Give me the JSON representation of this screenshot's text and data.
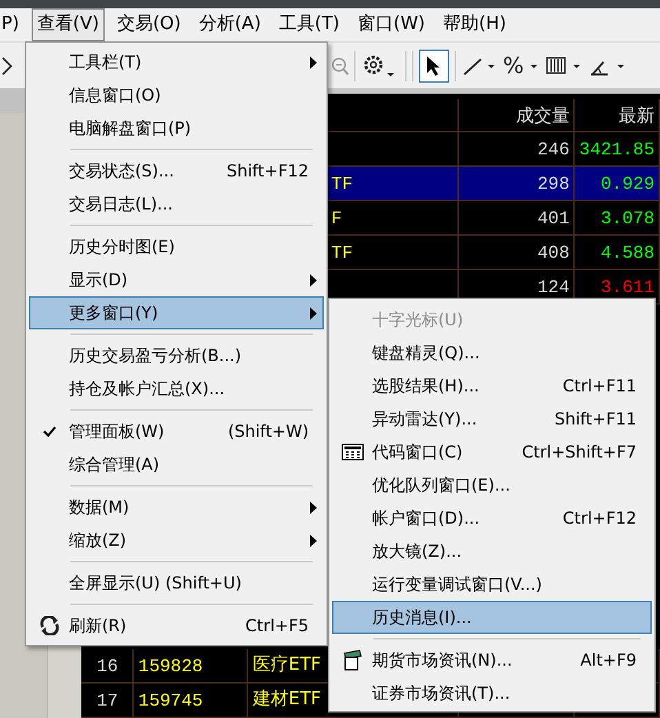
{
  "menubar": {
    "items": [
      {
        "label": "P)",
        "selected": false
      },
      {
        "label": "查看(V)",
        "selected": true
      },
      {
        "label": "交易(O)",
        "selected": false
      },
      {
        "label": "分析(A)",
        "selected": false
      },
      {
        "label": "工具(T)",
        "selected": false
      },
      {
        "label": "窗口(W)",
        "selected": false
      },
      {
        "label": "帮助(H)",
        "selected": false
      }
    ]
  },
  "toolbar": {
    "percent_button": "%"
  },
  "table": {
    "columns": [
      "成交量",
      "最新"
    ],
    "rows_top": [
      {
        "volume": "246",
        "latest": "3421.85",
        "color": "#00ff00",
        "selected": false
      },
      {
        "name": "TF",
        "volume": "298",
        "latest": "0.929",
        "color": "#00ff00",
        "selected": true
      },
      {
        "name": "F",
        "volume": "401",
        "latest": "3.078",
        "color": "#00ff00",
        "selected": false
      },
      {
        "name": "TF",
        "volume": "408",
        "latest": "4.588",
        "color": "#00ff00",
        "selected": false
      },
      {
        "volume": "124",
        "latest": "3.611",
        "color": "#ff0000",
        "selected": false
      }
    ],
    "rows_bottom": [
      {
        "index": "16",
        "code": "159828",
        "name": "医疗ETF",
        "selected": false
      },
      {
        "index": "17",
        "code": "159745",
        "name": "建材ETF",
        "selected": false
      }
    ]
  },
  "view_menu": {
    "items": [
      {
        "kind": "item",
        "label": "工具栏(T)",
        "submenu": true,
        "checked": false,
        "selected": false
      },
      {
        "kind": "item",
        "label": "信息窗口(O)",
        "submenu": false,
        "checked": false,
        "selected": false
      },
      {
        "kind": "item",
        "label": "电脑解盘窗口(P)",
        "submenu": false,
        "checked": false,
        "selected": false
      },
      {
        "kind": "separator"
      },
      {
        "kind": "item",
        "label": "交易状态(S)...",
        "shortcut": "Shift+F12",
        "submenu": false,
        "checked": false,
        "selected": false
      },
      {
        "kind": "item",
        "label": "交易日志(L)...",
        "submenu": false,
        "checked": false,
        "selected": false
      },
      {
        "kind": "separator"
      },
      {
        "kind": "item",
        "label": "历史分时图(E)",
        "submenu": false,
        "checked": false,
        "selected": false
      },
      {
        "kind": "item",
        "label": "显示(D)",
        "submenu": true,
        "checked": false,
        "selected": false
      },
      {
        "kind": "item",
        "label": "更多窗口(Y)",
        "submenu": true,
        "checked": false,
        "selected": true
      },
      {
        "kind": "separator"
      },
      {
        "kind": "item",
        "label": "历史交易盈亏分析(B...)",
        "submenu": false,
        "checked": false,
        "selected": false
      },
      {
        "kind": "item",
        "label": "持仓及帐户汇总(X)...",
        "submenu": false,
        "checked": false,
        "selected": false
      },
      {
        "kind": "separator"
      },
      {
        "kind": "item",
        "label": "管理面板(W)",
        "shortcut": "(Shift+W)",
        "submenu": false,
        "checked": true,
        "selected": false
      },
      {
        "kind": "item",
        "label": "综合管理(A)",
        "submenu": false,
        "checked": false,
        "selected": false
      },
      {
        "kind": "separator"
      },
      {
        "kind": "item",
        "label": "数据(M)",
        "submenu": true,
        "checked": false,
        "selected": false
      },
      {
        "kind": "item",
        "label": "缩放(Z)",
        "submenu": true,
        "checked": false,
        "selected": false
      },
      {
        "kind": "separator"
      },
      {
        "kind": "item",
        "label": "全屏显示(U) (Shift+U)",
        "submenu": false,
        "checked": false,
        "selected": false
      },
      {
        "kind": "separator"
      },
      {
        "kind": "refresh",
        "label": "刷新(R)",
        "shortcut": "Ctrl+F5",
        "submenu": false,
        "checked": false,
        "selected": false
      }
    ]
  },
  "more_windows_menu": {
    "items": [
      {
        "kind": "item",
        "label": "十字光标(U)",
        "disabled": true,
        "selected": false
      },
      {
        "kind": "item",
        "label": "键盘精灵(Q)...",
        "disabled": false,
        "selected": false
      },
      {
        "kind": "item",
        "label": "选股结果(H)...",
        "shortcut": "Ctrl+F11",
        "disabled": false,
        "selected": false
      },
      {
        "kind": "item",
        "label": "异动雷达(Y)...",
        "shortcut": "Shift+F11",
        "disabled": false,
        "selected": false
      },
      {
        "kind": "grid",
        "label": "代码窗口(C)",
        "shortcut": "Ctrl+Shift+F7",
        "disabled": false,
        "selected": false
      },
      {
        "kind": "item",
        "label": "优化队列窗口(E)...",
        "disabled": false,
        "selected": false
      },
      {
        "kind": "item",
        "label": "帐户窗口(D)...",
        "shortcut": "Ctrl+F12",
        "disabled": false,
        "selected": false
      },
      {
        "kind": "item",
        "label": "放大镜(Z)...",
        "disabled": false,
        "selected": false
      },
      {
        "kind": "item",
        "label": "运行变量调试窗口(V...)",
        "disabled": false,
        "selected": false
      },
      {
        "kind": "item",
        "label": "历史消息(I)...",
        "disabled": false,
        "selected": true
      },
      {
        "kind": "separator"
      },
      {
        "kind": "notepad",
        "label": "期货市场资讯(N)...",
        "shortcut": "Alt+F9",
        "disabled": false,
        "selected": false
      },
      {
        "kind": "item",
        "label": "证券市场资讯(T)...",
        "disabled": false,
        "selected": false
      }
    ]
  }
}
